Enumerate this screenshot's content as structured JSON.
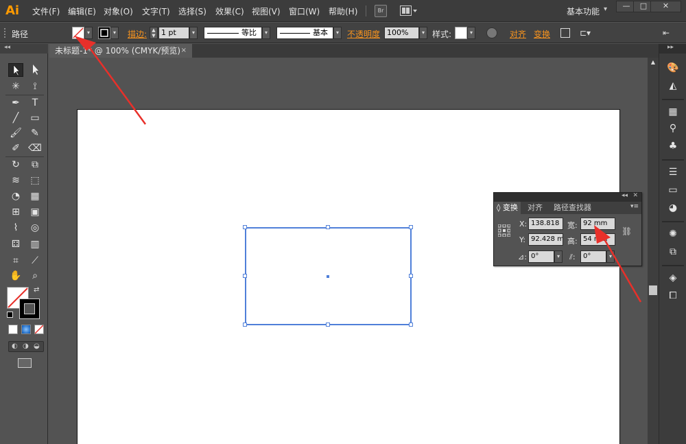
{
  "app": {
    "logo": "Ai",
    "workspace": "基本功能"
  },
  "menu": [
    "文件(F)",
    "编辑(E)",
    "对象(O)",
    "文字(T)",
    "选择(S)",
    "效果(C)",
    "视图(V)",
    "窗口(W)",
    "帮助(H)"
  ],
  "menubar": {
    "bridge": "Br"
  },
  "window_controls": {
    "minimize": "—",
    "restore": "□",
    "close": "✕"
  },
  "control": {
    "object_type": "路径",
    "stroke_label": "描边:",
    "stroke_weight": "1 pt",
    "profile_uniform": "等比",
    "brush_basic": "基本",
    "opacity_label": "不透明度",
    "opacity_value": "100%",
    "style_label": "样式:",
    "align_label": "对齐",
    "transform_label": "变换"
  },
  "document": {
    "tab_title": "未标题-1* @ 100% (CMYK/预览)",
    "close": "×"
  },
  "transform_panel": {
    "tabs": [
      "◊ 变换",
      "对齐",
      "路径查找器"
    ],
    "x_label": "X:",
    "x_value": "138.818",
    "y_label": "Y:",
    "y_value": "92.428 m",
    "w_label": "宽:",
    "w_value": "92 mm",
    "h_label": "高:",
    "h_value": "54 mm",
    "rotate_value": "0°",
    "shear_value": "0°"
  },
  "colors": {
    "accent_orange": "#f7931e",
    "selection_blue": "#4f7fd9",
    "annotation_red": "#e8302a"
  }
}
